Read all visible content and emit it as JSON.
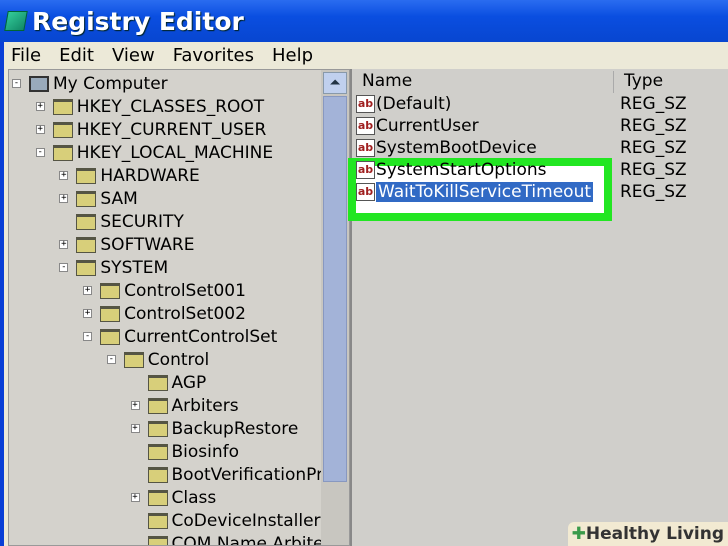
{
  "title": "Registry Editor",
  "menu": [
    "File",
    "Edit",
    "View",
    "Favorites",
    "Help"
  ],
  "tree": [
    {
      "label": "My Computer",
      "toggle": "-"
    },
    {
      "label": "HKEY_CLASSES_ROOT",
      "toggle": "+"
    },
    {
      "label": "HKEY_CURRENT_USER",
      "toggle": "+"
    },
    {
      "label": "HKEY_LOCAL_MACHINE",
      "toggle": "-"
    },
    {
      "label": "HARDWARE",
      "toggle": "+"
    },
    {
      "label": "SAM",
      "toggle": "+"
    },
    {
      "label": "SECURITY",
      "toggle": ""
    },
    {
      "label": "SOFTWARE",
      "toggle": "+"
    },
    {
      "label": "SYSTEM",
      "toggle": "-"
    },
    {
      "label": "ControlSet001",
      "toggle": "+"
    },
    {
      "label": "ControlSet002",
      "toggle": "+"
    },
    {
      "label": "CurrentControlSet",
      "toggle": "-"
    },
    {
      "label": "Control",
      "toggle": "-"
    },
    {
      "label": "AGP",
      "toggle": ""
    },
    {
      "label": "Arbiters",
      "toggle": "+"
    },
    {
      "label": "BackupRestore",
      "toggle": "+"
    },
    {
      "label": "Biosinfo",
      "toggle": ""
    },
    {
      "label": "BootVerificationProgram",
      "toggle": ""
    },
    {
      "label": "Class",
      "toggle": "+"
    },
    {
      "label": "CoDeviceInstallers",
      "toggle": ""
    },
    {
      "label": "COM Name Arbiter",
      "toggle": ""
    }
  ],
  "columns": {
    "name": "Name",
    "type": "Type"
  },
  "values": [
    {
      "name": "(Default)",
      "type": "REG_SZ"
    },
    {
      "name": "CurrentUser",
      "type": "REG_SZ"
    },
    {
      "name": "SystemBootDevice",
      "type": "REG_SZ"
    },
    {
      "name": "SystemStartOptions",
      "type": "REG_SZ"
    },
    {
      "name": "WaitToKillServiceTimeout",
      "type": "REG_SZ"
    }
  ],
  "icons": {
    "value": "ab",
    "scroll_up": "⏶"
  },
  "watermark": "Healthy Living",
  "highlight_color": "#22e622"
}
